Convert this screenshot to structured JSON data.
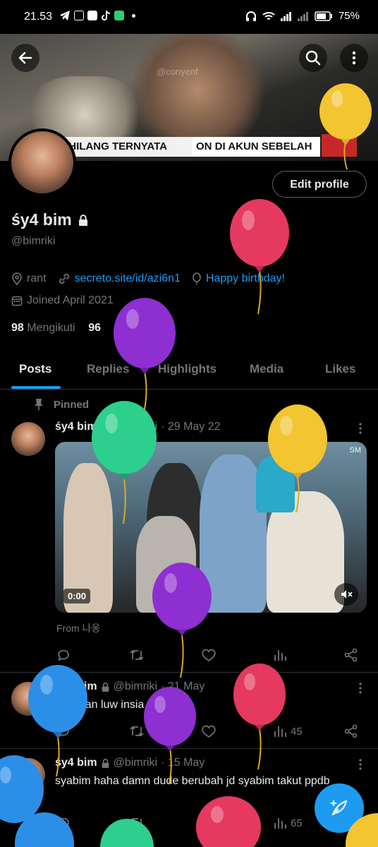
{
  "status_bar": {
    "time": "21.53",
    "battery": "75%",
    "icons": [
      "telegram-icon",
      "instagram-icon",
      "shopee-icon",
      "tiktok-icon",
      "chat-icon",
      "dot-icon",
      "headphones-icon",
      "wifi-icon",
      "signal-icon",
      "signal-x-icon",
      "battery-icon"
    ]
  },
  "banner": {
    "watermark": "@conyenf",
    "caption_left": "KA HILANG TERNYATA",
    "caption_right": "ON DI AKUN SEBELAH"
  },
  "header": {
    "back_icon": "back-arrow-icon",
    "search_icon": "search-icon",
    "more_icon": "more-vertical-icon"
  },
  "profile": {
    "edit_label": "Edit profile",
    "name": "śy4 bim",
    "handle": "@bimriki",
    "location": "rant",
    "website": "secreto.site/id/azi6n1",
    "birthday": "Happy birthday!",
    "joined": "Joined April 2021",
    "following_count": "98",
    "following_label": "Mengikuti",
    "followers_count": "96"
  },
  "tabs": [
    "Posts",
    "Replies",
    "Highlights",
    "Media",
    "Likes"
  ],
  "posts": [
    {
      "pinned_label": "Pinned",
      "name": "śy4 bim",
      "handle": "@bimriki",
      "date": "· 29 May 22",
      "video_time": "0:00",
      "video_badge": "SM",
      "from": "From 나옹"
    },
    {
      "name": "śy4 bim",
      "handle": "@bimriki",
      "date": "· 21 May",
      "text": "bajingan luw insia",
      "views": "45"
    },
    {
      "name": "śy4 bim",
      "handle": "@bimriki",
      "date": "· 15 May",
      "text": "syabim haha damn dude berubah jd syabim takut ppdb",
      "views": "65"
    }
  ],
  "colors": {
    "accent": "#1d9bf0",
    "balloon_yellow": "#f2c531",
    "balloon_red": "#e6395f",
    "balloon_purple": "#8e2fd1",
    "balloon_green": "#2ccf8c",
    "balloon_blue": "#2b8fe8"
  }
}
